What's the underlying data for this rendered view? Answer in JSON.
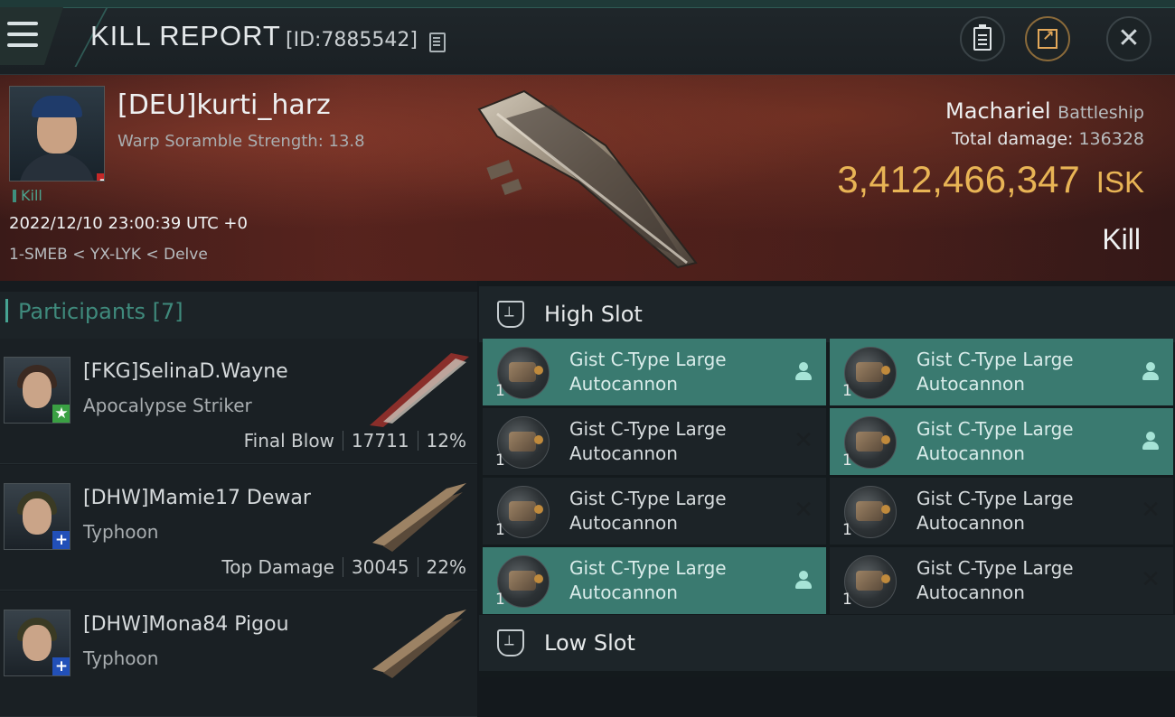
{
  "header": {
    "title": "KILL REPORT",
    "id_label": "[ID:7885542]"
  },
  "victim": {
    "name": "[DEU]kurti_harz",
    "subtitle": "Warp Soramble Strength: 13.8",
    "kill_tag": "Kill",
    "timestamp": "2022/12/10 23:00:39 UTC +0",
    "location": "1-SMEB < YX-LYK < Delve",
    "status_badge": "−"
  },
  "ship": {
    "name": "Machariel",
    "class": "Battleship",
    "total_damage_label": "Total damage:",
    "total_damage_value": "136328",
    "isk_value": "3,412,466,347",
    "isk_unit": "ISK",
    "result": "Kill"
  },
  "participants": {
    "title": "Participants [7]",
    "items": [
      {
        "name": "[FKG]SelinaD.Wayne",
        "ship": "Apocalypse Striker",
        "role": "Final Blow",
        "damage": "17711",
        "percent": "12%",
        "badge": "★",
        "badge_color": "green"
      },
      {
        "name": "[DHW]Mamie17 Dewar",
        "ship": "Typhoon",
        "role": "Top Damage",
        "damage": "30045",
        "percent": "22%",
        "badge": "+",
        "badge_color": "blue"
      },
      {
        "name": "[DHW]Mona84 Pigou",
        "ship": "Typhoon",
        "role": "",
        "damage": "",
        "percent": "",
        "badge": "+",
        "badge_color": "blue"
      }
    ]
  },
  "slots": {
    "high_title": "High Slot",
    "low_title": "Low Slot",
    "high_modules": [
      {
        "line1": "Gist C-Type Large",
        "line2": "Autocannon",
        "qty": "1",
        "status": "fitted"
      },
      {
        "line1": "Gist C-Type Large",
        "line2": "Autocannon",
        "qty": "1",
        "status": "fitted"
      },
      {
        "line1": "Gist C-Type Large",
        "line2": "Autocannon",
        "qty": "1",
        "status": "destroyed"
      },
      {
        "line1": "Gist C-Type Large",
        "line2": "Autocannon",
        "qty": "1",
        "status": "fitted"
      },
      {
        "line1": "Gist C-Type Large",
        "line2": "Autocannon",
        "qty": "1",
        "status": "destroyed"
      },
      {
        "line1": "Gist C-Type Large",
        "line2": "Autocannon",
        "qty": "1",
        "status": "destroyed"
      },
      {
        "line1": "Gist C-Type Large",
        "line2": "Autocannon",
        "qty": "1",
        "status": "fitted"
      },
      {
        "line1": "Gist C-Type Large",
        "line2": "Autocannon",
        "qty": "1",
        "status": "destroyed"
      }
    ]
  },
  "colors": {
    "accent_teal": "#3a7a70",
    "isk_gold": "#e8b455",
    "kill_green": "#4ca38e"
  }
}
